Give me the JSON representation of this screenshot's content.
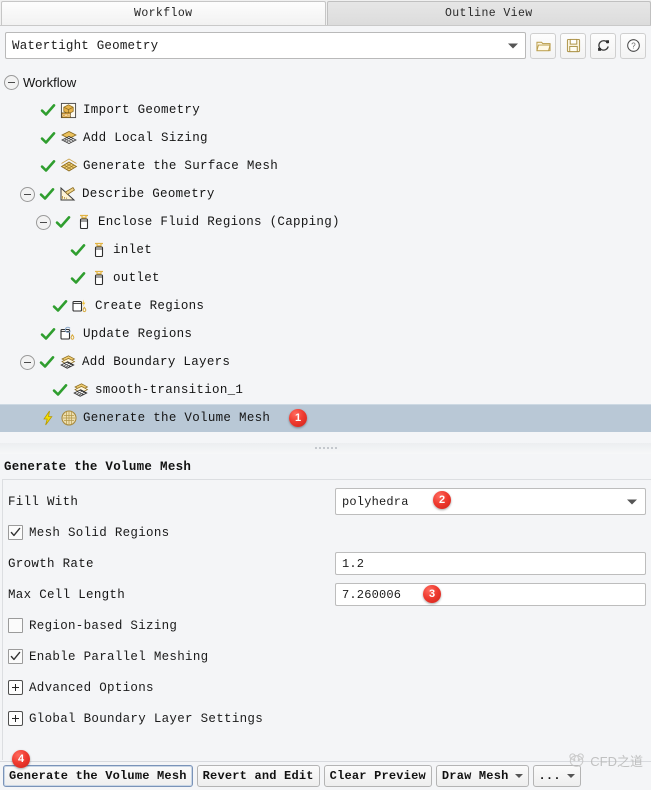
{
  "tabs": [
    {
      "label": "Workflow",
      "active": true
    },
    {
      "label": "Outline View",
      "active": false
    }
  ],
  "toolbar": {
    "workflow_value": "Watertight Geometry",
    "icons": [
      {
        "name": "open-folder-icon",
        "title": "Load Workflow"
      },
      {
        "name": "save-disk-icon",
        "title": "Save Workflow"
      },
      {
        "name": "reset-refresh-icon",
        "title": "Reset Workflow"
      },
      {
        "name": "help-question-icon",
        "title": "Help"
      }
    ]
  },
  "tree": {
    "root_label": "Workflow",
    "items": [
      {
        "label": "Import Geometry",
        "indent": 1,
        "state": "done",
        "icon": "cad-box-icon",
        "expander": "none"
      },
      {
        "label": "Add Local Sizing",
        "indent": 1,
        "state": "done",
        "icon": "local-sizing-icon",
        "expander": "none"
      },
      {
        "label": "Generate the Surface Mesh",
        "indent": 1,
        "state": "done",
        "icon": "surface-mesh-icon",
        "expander": "none"
      },
      {
        "label": "Describe Geometry",
        "indent": 1,
        "state": "done",
        "icon": "describe-geom-icon",
        "expander": "minus"
      },
      {
        "label": "Enclose Fluid Regions (Capping)",
        "indent": 2,
        "state": "done",
        "icon": "capping-icon",
        "expander": "minus"
      },
      {
        "label": "inlet",
        "indent": 3,
        "state": "done",
        "icon": "capping-icon",
        "expander": "none"
      },
      {
        "label": "outlet",
        "indent": 3,
        "state": "done",
        "icon": "capping-icon",
        "expander": "none"
      },
      {
        "label": "Create Regions",
        "indent": 2,
        "state": "done",
        "icon": "create-regions-icon",
        "expander": "none"
      },
      {
        "label": "Update Regions",
        "indent": 1,
        "state": "done",
        "icon": "update-regions-icon",
        "expander": "none"
      },
      {
        "label": "Add Boundary Layers",
        "indent": 1,
        "state": "done",
        "icon": "boundary-layer-icon",
        "expander": "minus"
      },
      {
        "label": "smooth-transition_1",
        "indent": 2,
        "state": "done",
        "icon": "boundary-layer-icon",
        "expander": "none"
      },
      {
        "label": "Generate the Volume Mesh",
        "indent": 1,
        "state": "current",
        "icon": "volume-mesh-icon",
        "expander": "none",
        "selected": true,
        "badge": "1"
      }
    ]
  },
  "properties": {
    "title": "Generate the Volume Mesh",
    "rows": [
      {
        "type": "dropdown",
        "label": "Fill With",
        "value": "polyhedra",
        "badge": "2"
      },
      {
        "type": "checkbox",
        "label": "Mesh Solid Regions",
        "checked": true
      },
      {
        "type": "text",
        "label": "Growth Rate",
        "value": "1.2"
      },
      {
        "type": "text",
        "label": "Max Cell Length",
        "value": "7.260006",
        "badge": "3"
      },
      {
        "type": "checkbox",
        "label": "Region-based Sizing",
        "checked": false
      },
      {
        "type": "checkbox",
        "label": "Enable Parallel Meshing",
        "checked": true
      },
      {
        "type": "expand",
        "label": "Advanced Options"
      },
      {
        "type": "expand",
        "label": "Global Boundary Layer Settings"
      }
    ]
  },
  "bottom": {
    "buttons": [
      {
        "label": "Generate the Volume Mesh",
        "primary": true,
        "split": false,
        "badge": "4"
      },
      {
        "label": "Revert and Edit",
        "primary": false,
        "split": false
      },
      {
        "label": "Clear Preview",
        "primary": false,
        "split": false
      },
      {
        "label": "Draw Mesh",
        "primary": false,
        "split": true
      },
      {
        "label": "...",
        "primary": false,
        "split": true
      }
    ]
  },
  "watermark": {
    "text": "CFD之道",
    "icon": "panda-face-icon"
  },
  "colors": {
    "selection": "#b9c8d6",
    "badge_red": "#ef3b30",
    "check_green": "#2f9e2f",
    "panel_bg": "#f4f5f7"
  }
}
